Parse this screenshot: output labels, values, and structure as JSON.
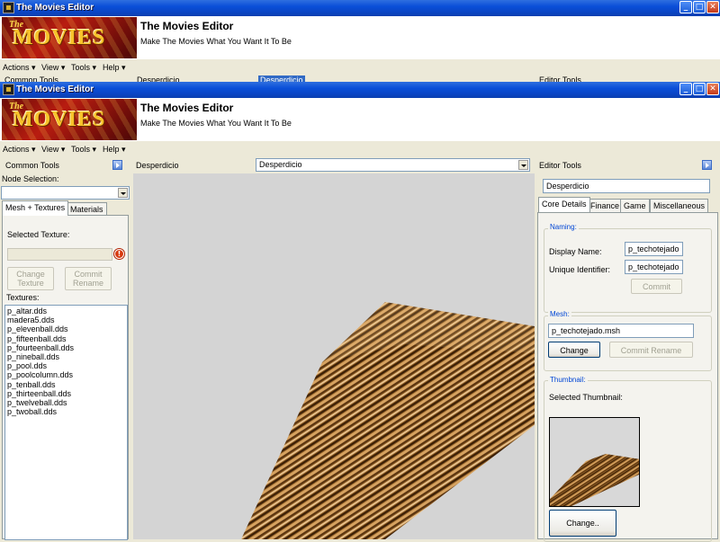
{
  "window": {
    "title": "The Movies Editor",
    "controls": {
      "minimize": "_",
      "maximize": "□",
      "close": "✕"
    }
  },
  "header": {
    "logo_the": "The",
    "logo_word": "MOVIES",
    "title": "The Movies Editor",
    "subtitle": "Make The Movies What You Want It To Be"
  },
  "menubar": {
    "items": [
      {
        "label": "Actions ▾"
      },
      {
        "label": "View ▾"
      },
      {
        "label": "Tools ▾"
      },
      {
        "label": "Help ▾"
      }
    ]
  },
  "background_window": {
    "left_title": "Common Tools",
    "dropdown_label": "Desperdicio",
    "dropdown_value": "Desperdicio",
    "right_title": "Editor Tools"
  },
  "left_panel": {
    "title": "Common Tools",
    "node_selection_label": "Node Selection:",
    "node_selection_value": "",
    "tabs": [
      {
        "label": "Mesh + Textures",
        "active": true
      },
      {
        "label": "Materials",
        "active": false
      }
    ],
    "selected_texture_label": "Selected Texture:",
    "selected_texture_value": "",
    "change_texture_label": "Change Texture",
    "commit_rename_label": "Commit Rename",
    "textures_label": "Textures:",
    "textures": [
      "p_altar.dds",
      "madera5.dds",
      "p_elevenball.dds",
      "p_fifteenball.dds",
      "p_fourteenball.dds",
      "p_nineball.dds",
      "p_pool.dds",
      "p_poolcolumn.dds",
      "p_tenball.dds",
      "p_thirteenball.dds",
      "p_twelveball.dds",
      "p_twoball.dds"
    ]
  },
  "center": {
    "node_label": "Desperdicio",
    "node_dropdown_value": "Desperdicio"
  },
  "right_panel": {
    "title": "Editor Tools",
    "name_value": "Desperdicio",
    "tabs": [
      {
        "label": "Core Details",
        "active": true
      },
      {
        "label": "Finance",
        "active": false
      },
      {
        "label": "Game",
        "active": false
      },
      {
        "label": "Miscellaneous",
        "active": false
      }
    ],
    "naming": {
      "group_label": "Naming:",
      "display_name_label": "Display Name:",
      "display_name_value": "p_techotejado",
      "unique_id_label": "Unique Identifier:",
      "unique_id_value": "p_techotejado",
      "commit_label": "Commit"
    },
    "mesh": {
      "group_label": "Mesh:",
      "mesh_value": "p_techotejado.msh",
      "change_label": "Change",
      "commit_rename_label": "Commit Rename"
    },
    "thumbnail": {
      "group_label": "Thumbnail:",
      "selected_label": "Selected Thumbnail:",
      "change_label": "Change.."
    }
  },
  "colors": {
    "titlebar": "#0a4fd8",
    "window_bg": "#ece9d8",
    "group_label": "#0046d5"
  }
}
